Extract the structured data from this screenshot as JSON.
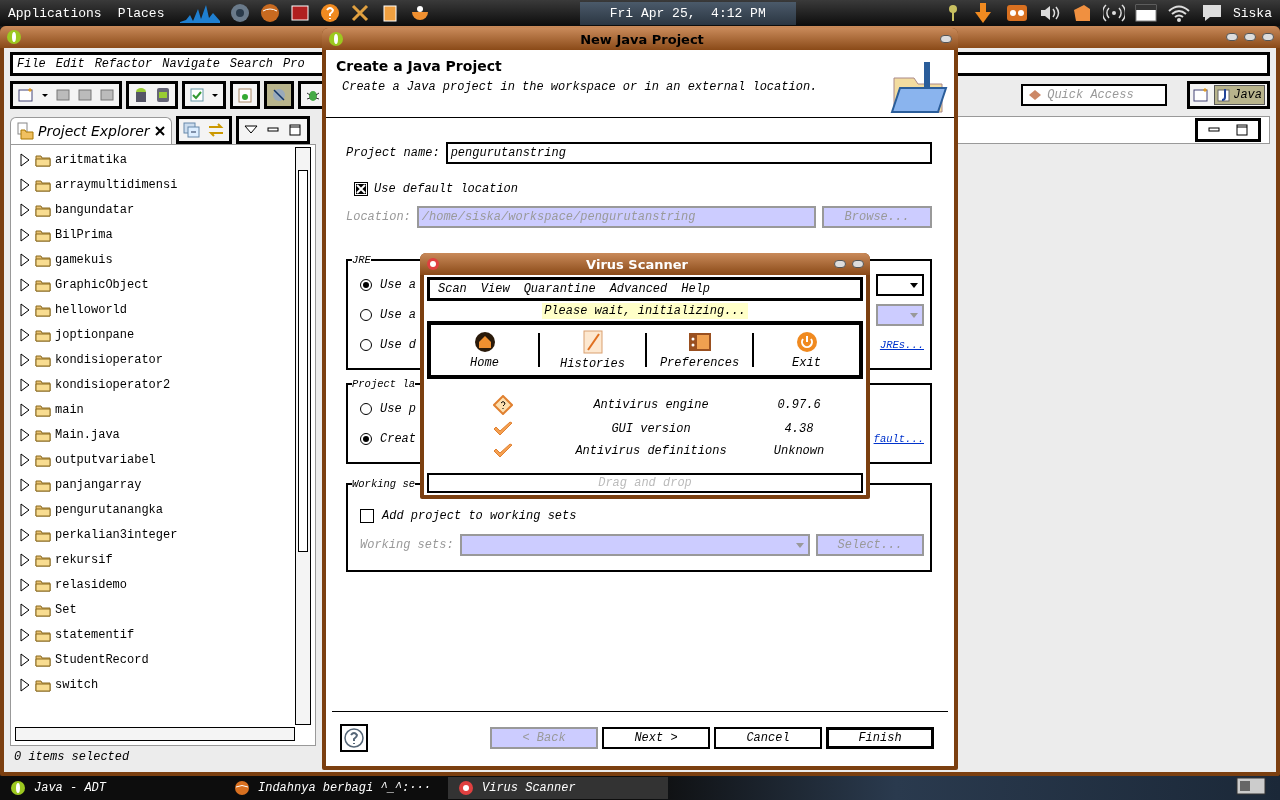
{
  "top_panel": {
    "menus": [
      "Applications",
      "Places"
    ],
    "clock": "Fri Apr 25,  4:12 PM",
    "user": "Siska"
  },
  "eclipse": {
    "menu": [
      "File",
      "Edit",
      "Refactor",
      "Navigate",
      "Search",
      "Pro"
    ],
    "quick_access": {
      "placeholder": "Quick Access"
    },
    "perspective": {
      "label": "Java",
      "selected": true
    },
    "explorer": {
      "tab": "Project Explorer",
      "items": [
        {
          "label": "aritmatika",
          "expanded": false
        },
        {
          "label": "arraymultidimensi",
          "expanded": false
        },
        {
          "label": "bangundatar",
          "expanded": false
        },
        {
          "label": "BilPrima",
          "expanded": false
        },
        {
          "label": "gamekuis",
          "expanded": false
        },
        {
          "label": "GraphicObject",
          "expanded": false
        },
        {
          "label": "helloworld",
          "expanded": false
        },
        {
          "label": "joptionpane",
          "expanded": false
        },
        {
          "label": "kondisioperator",
          "expanded": false
        },
        {
          "label": "kondisioperator2",
          "expanded": false
        },
        {
          "label": "main",
          "expanded": false
        },
        {
          "label": "Main.java",
          "expanded": false
        },
        {
          "label": "outputvariabel",
          "expanded": false
        },
        {
          "label": "panjangarray",
          "expanded": false
        },
        {
          "label": "pengurutanangka",
          "expanded": false
        },
        {
          "label": "perkalian3integer",
          "expanded": false
        },
        {
          "label": "rekursif",
          "expanded": false
        },
        {
          "label": "relasidemo",
          "expanded": false
        },
        {
          "label": "Set",
          "expanded": false
        },
        {
          "label": "statementif",
          "expanded": false
        },
        {
          "label": "StudentRecord",
          "expanded": false
        },
        {
          "label": "switch",
          "expanded": false
        }
      ]
    },
    "status_bar": "0 items selected"
  },
  "dialog": {
    "title": "New Java Project",
    "heading": "Create a Java Project",
    "description": "Create a Java project in the workspace or in an external location.",
    "project_name": {
      "label": "Project name:",
      "value": "pengurutanstring"
    },
    "default_location": {
      "label": "Use default location",
      "checked": true
    },
    "location": {
      "label": "Location:",
      "value": "/home/siska/workspace/pengurutanstring",
      "disabled": true
    },
    "browse": {
      "label": "Browse...",
      "disabled": true
    },
    "jre": {
      "title": "JRE",
      "options": [
        {
          "label": "Use a",
          "selected": true
        },
        {
          "label": "Use a",
          "selected": false
        },
        {
          "label": "Use d",
          "selected": false
        }
      ],
      "link": "JREs..."
    },
    "layout": {
      "title": "Project la",
      "options": [
        {
          "label": "Use p",
          "selected": false
        },
        {
          "label": "Creat",
          "selected": true
        }
      ],
      "link": "fault..."
    },
    "working_sets": {
      "title": "Working se",
      "add": {
        "label": "Add project to working sets",
        "checked": false
      },
      "sets_label": "Working sets:",
      "select": {
        "label": "Select...",
        "disabled": true
      }
    },
    "buttons": [
      {
        "label": "< Back",
        "disabled": true
      },
      {
        "label": "Next >",
        "disabled": false
      },
      {
        "label": "Cancel",
        "disabled": false
      },
      {
        "label": "Finish",
        "disabled": false
      }
    ]
  },
  "virus_scanner": {
    "title": "Virus Scanner",
    "menu": [
      "Scan",
      "View",
      "Quarantine",
      "Advanced",
      "Help"
    ],
    "status": "Please wait, initializing...",
    "tools": [
      {
        "label": "Home",
        "kind": "home"
      },
      {
        "label": "Histories",
        "kind": "histories"
      },
      {
        "label": "Preferences",
        "kind": "preferences"
      },
      {
        "label": "Exit",
        "kind": "exit"
      }
    ],
    "info": [
      {
        "kind": "unknown",
        "name": "Antivirus engine",
        "value": "0.97.6"
      },
      {
        "kind": "ok",
        "name": "GUI version",
        "value": "4.38"
      },
      {
        "kind": "ok",
        "name": "Antivirus definitions",
        "value": "Unknown"
      }
    ],
    "drop_zone": {
      "placeholder": "Drag and drop"
    }
  },
  "taskbar": [
    {
      "label": "Java - ADT",
      "kind": "eclipse"
    },
    {
      "label": "Indahnya berbagi ^_^:···",
      "kind": "browser"
    },
    {
      "label": "Virus Scanner",
      "kind": "scanner"
    }
  ]
}
